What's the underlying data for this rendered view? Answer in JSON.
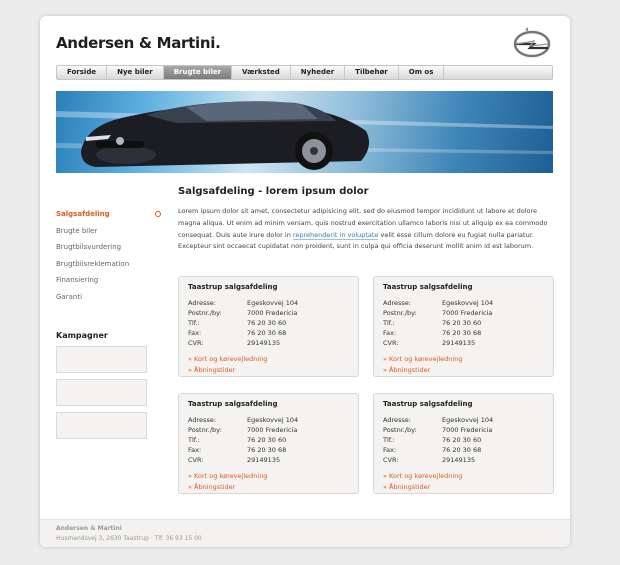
{
  "header": {
    "site_title": "Andersen & Martini."
  },
  "brand": {
    "logo_icon": "opel-logo-icon"
  },
  "nav": {
    "items": [
      {
        "label": "Forside"
      },
      {
        "label": "Nye biler"
      },
      {
        "label": "Brugte biler"
      },
      {
        "label": "Værksted"
      },
      {
        "label": "Nyheder"
      },
      {
        "label": "Tilbehør"
      },
      {
        "label": "Om os"
      }
    ],
    "active_index": 2
  },
  "hero": {
    "image": "car-hero-image"
  },
  "sidebar": {
    "items": [
      {
        "label": "Salgsafdeling"
      },
      {
        "label": "Brugte biler"
      },
      {
        "label": "Brugtbilsvurdering"
      },
      {
        "label": "Brugtbilsreklemation"
      },
      {
        "label": "Finansiering"
      },
      {
        "label": "Garanti"
      }
    ],
    "campaigns_title": "Kampagner"
  },
  "main": {
    "title": "Salgsafdeling - lorem ipsum dolor",
    "text_before_link": "Lorem ipsum dolor sit amet, consectetur adipisicing elit, sed do eiusmod tempor incididunt ut labore et dolore magna aliqua. Ut enim ad minim veniam, quis nostrud exercitation ullamco laboris nisi ut aliquip ex ea commodo consequat. Duis aute irure dolor in ",
    "link_text": "reprehenderit in voluptate",
    "text_after_link": " velit esse cillum dolore eu fugiat nulla pariatur. Excepteur sint occaecat cupidatat non proident, sunt in culpa qui officia deserunt mollit anim id est laborum."
  },
  "cards": [
    {
      "title": "Taastrup salgsafdeling",
      "rows": [
        {
          "k": "Adresse:",
          "v": "Egeskovvej 104"
        },
        {
          "k": "Postnr./by:",
          "v": "7000 Fredericia"
        },
        {
          "k": "Tlf.:",
          "v": "76 20 30 60"
        },
        {
          "k": "Fax:",
          "v": "76 20 30 68"
        },
        {
          "k": "CVR:",
          "v": "29149135"
        }
      ],
      "links": [
        "» Kort og kørevejledning",
        "» Åbningstider"
      ]
    },
    {
      "title": "Taastrup salgsafdeling",
      "rows": [
        {
          "k": "Adresse:",
          "v": "Egeskovvej 104"
        },
        {
          "k": "Postnr./by:",
          "v": "7000 Fredericia"
        },
        {
          "k": "Tlf.:",
          "v": "76 20 30 60"
        },
        {
          "k": "Fax:",
          "v": "76 20 30 68"
        },
        {
          "k": "CVR:",
          "v": "29149135"
        }
      ],
      "links": [
        "» Kort og kørevejledning",
        "» Åbningstider"
      ]
    },
    {
      "title": "Taastrup salgsafdeling",
      "rows": [
        {
          "k": "Adresse:",
          "v": "Egeskovvej 104"
        },
        {
          "k": "Postnr./by:",
          "v": "7000 Fredericia"
        },
        {
          "k": "Tlf.:",
          "v": "76 20 30 60"
        },
        {
          "k": "Fax:",
          "v": "76 20 30 68"
        },
        {
          "k": "CVR:",
          "v": "29149135"
        }
      ],
      "links": [
        "» Kort og kørevejledning",
        "» Åbningstider"
      ]
    },
    {
      "title": "Taastrup salgsafdeling",
      "rows": [
        {
          "k": "Adresse:",
          "v": "Egeskovvej 104"
        },
        {
          "k": "Postnr./by:",
          "v": "7000 Fredericia"
        },
        {
          "k": "Tlf.:",
          "v": "76 20 30 60"
        },
        {
          "k": "Fax:",
          "v": "76 20 30 68"
        },
        {
          "k": "CVR:",
          "v": "29149135"
        }
      ],
      "links": [
        "» Kort og kørevejledning",
        "» Åbningstider"
      ]
    }
  ],
  "footer": {
    "company": "Andersen & Martini",
    "address": "Husmandsvej 3, 2630 Taastrup",
    "phone": "Tlf. 36 93 15 00"
  },
  "colors": {
    "accent": "#e05b1a",
    "link": "#2f7fb8"
  }
}
